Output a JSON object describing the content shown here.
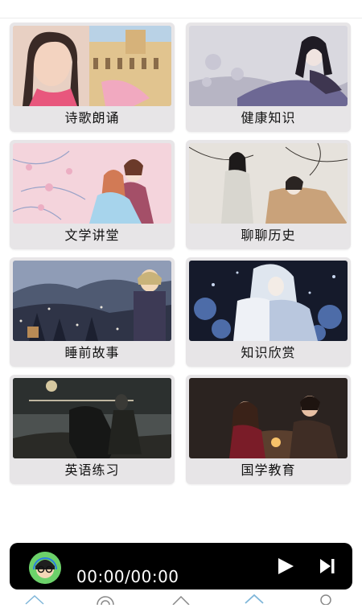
{
  "cards": [
    {
      "label": "诗歌朗诵",
      "name": "poetry"
    },
    {
      "label": "健康知识",
      "name": "health"
    },
    {
      "label": "文学讲堂",
      "name": "literature"
    },
    {
      "label": "聊聊历史",
      "name": "history"
    },
    {
      "label": "睡前故事",
      "name": "bedtime-stories"
    },
    {
      "label": "知识欣赏",
      "name": "knowledge"
    },
    {
      "label": "英语练习",
      "name": "english"
    },
    {
      "label": "国学教育",
      "name": "sinology"
    }
  ],
  "player": {
    "time": "00:00/00:00",
    "play_icon": "play-icon",
    "next_icon": "skip-next-icon"
  },
  "tabbar": {
    "icons": [
      "home-icon",
      "radio-icon",
      "discover-icon",
      "learn-icon",
      "profile-icon"
    ],
    "active_color": "#7fb6d9"
  }
}
